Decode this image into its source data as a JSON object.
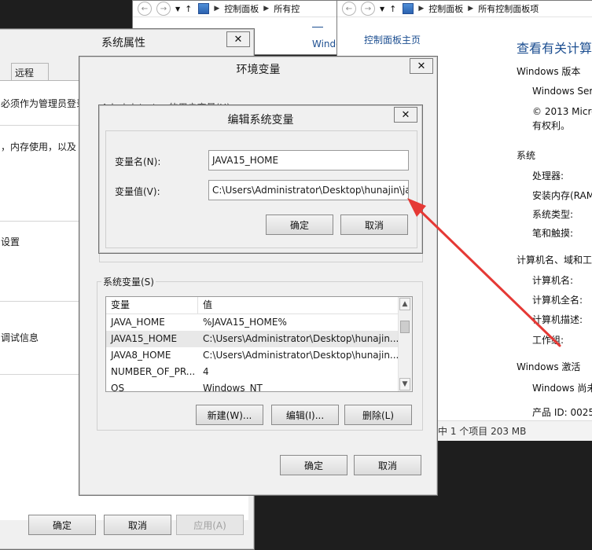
{
  "cp_window_1": {
    "breadcrumb": [
      "控制面板",
      "所有控"
    ],
    "partial_text": "Windo"
  },
  "cp_window_2": {
    "breadcrumb": [
      "控制面板",
      "所有控制面板项"
    ],
    "sidebar_link": "控制面板主页",
    "heading": "查看有关计算",
    "sections": {
      "windows_edition": "Windows 版本",
      "edition_value": "Windows Ser",
      "copyright_1": "© 2013 Micro",
      "copyright_2": "有权利。",
      "system": "系统",
      "processor": "处理器:",
      "memory": "安装内存(RAM",
      "system_type": "系统类型:",
      "pen_touch": "笔和触摸:",
      "computer_name_domain": "计算机名、域和工",
      "computer_name": "计算机名:",
      "full_computer_name": "计算机全名:",
      "computer_description": "计算机描述:",
      "workgroup": "工作组:",
      "activation": "Windows 激活",
      "activation_status": "Windows 尚未",
      "product_id": "产品 ID: 0025"
    },
    "status_bar": "选中 1 个项目  203 MB"
  },
  "sys_props": {
    "title": "系统属性",
    "tab_remote": "远程",
    "line_admin": "必须作为管理员登录",
    "line_memory": "，内存使用，以及",
    "line_settings": "设置",
    "line_debug": "调试信息",
    "ok": "确定",
    "cancel": "取消",
    "apply": "应用(A)"
  },
  "env_vars": {
    "title": "环境变量",
    "user_vars_label_partial": "Administrator 的用户变量(U)",
    "system_vars_label": "系统变量(S)",
    "columns": [
      "变量",
      "值"
    ],
    "rows": [
      {
        "name": "JAVA_HOME",
        "value": "%JAVA15_HOME%"
      },
      {
        "name": "JAVA15_HOME",
        "value": "C:\\Users\\Administrator\\Desktop\\hunajin..."
      },
      {
        "name": "JAVA8_HOME",
        "value": "C:\\Users\\Administrator\\Desktop\\hunajin..."
      },
      {
        "name": "NUMBER_OF_PR...",
        "value": "4"
      },
      {
        "name": "OS",
        "value": "Windows_NT"
      }
    ],
    "new": "新建(W)...",
    "edit": "编辑(I)...",
    "delete": "删除(L)",
    "ok": "确定",
    "cancel": "取消"
  },
  "edit_var": {
    "title": "编辑系统变量",
    "name_label": "变量名(N):",
    "name_value": "JAVA15_HOME",
    "value_label": "变量值(V):",
    "value_value": "C:\\Users\\Administrator\\Desktop\\hunajin\\ja",
    "ok": "确定",
    "cancel": "取消"
  },
  "colors": {
    "annotation_arrow": "#e53935",
    "link_blue": "#1d4f91"
  }
}
